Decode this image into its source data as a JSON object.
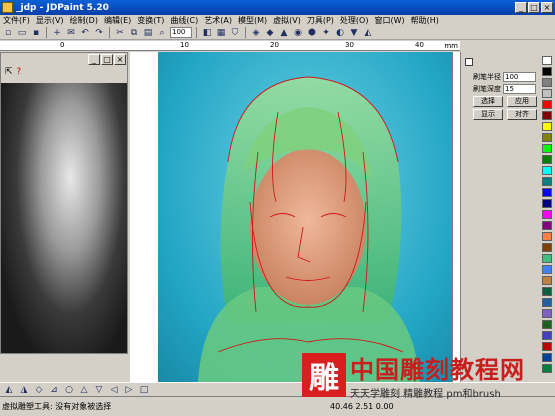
{
  "window": {
    "title": "_jdp - JDPaint 5.20",
    "btn_min": "_",
    "btn_max": "□",
    "btn_close": "×"
  },
  "menu": [
    "文件(F)",
    "显示(V)",
    "绘制(D)",
    "编辑(E)",
    "变换(T)",
    "曲线(C)",
    "艺术(A)",
    "模型(M)",
    "虚拟(V)",
    "刀具(P)",
    "处理(O)",
    "窗口(W)",
    "帮助(H)"
  ],
  "toolbar": {
    "zoom_value": "100"
  },
  "ruler": {
    "ticks": [
      "0",
      "10",
      "20",
      "30",
      "40"
    ],
    "unit": "mm"
  },
  "panel": {
    "label_size": "刷笔半径",
    "value_size": "100",
    "label_depth": "刷笔深度",
    "value_depth": "15",
    "btn_select": "选择",
    "btn_apply": "应用",
    "btn_show": "显示",
    "btn_align": "对齐"
  },
  "palette_colors": [
    "#ffffff",
    "#000000",
    "#808080",
    "#c0c0c0",
    "#ff0000",
    "#800000",
    "#ffff00",
    "#808000",
    "#00ff00",
    "#008000",
    "#00ffff",
    "#008080",
    "#0000ff",
    "#000080",
    "#ff00ff",
    "#800080",
    "#ff8040",
    "#804000",
    "#40c080",
    "#4080ff",
    "#c08040",
    "#006040",
    "#2060a0",
    "#8060c0",
    "#206020",
    "#4040c0",
    "#c00000",
    "#0040a0",
    "#008040"
  ],
  "status": {
    "text": "虚拟雕塑工具: 没有对象被选择",
    "coords": "40.46  2.51  0.00"
  },
  "watermark": {
    "logo_char": "雕",
    "title": "中国雕刻教程网",
    "subtitle": "天天学雕刻 精雕教程 pm和brush"
  }
}
